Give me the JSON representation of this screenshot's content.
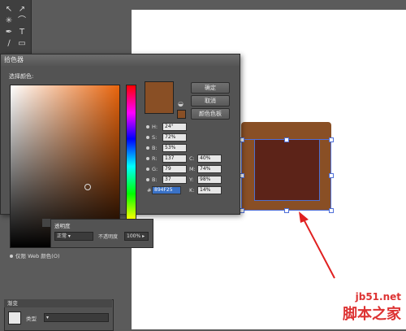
{
  "dialog": {
    "title": "拾色器",
    "select_label": "选择颜色:",
    "ok": "确定",
    "cancel": "取消",
    "swatches": "颜色色板",
    "web_only": "仅限 Web 颜色(O)",
    "current_color": "#894F25",
    "fields": [
      {
        "label": "H:",
        "value": "24°"
      },
      {
        "label": "S:",
        "value": "72%"
      },
      {
        "label": "B:",
        "value": "53%"
      },
      {
        "label": "R:",
        "value": "137"
      },
      {
        "label": "G:",
        "value": "79"
      },
      {
        "label": "B:",
        "value": "37"
      }
    ],
    "cmyk": [
      {
        "label": "C:",
        "value": "40%"
      },
      {
        "label": "M:",
        "value": "74%"
      },
      {
        "label": "Y:",
        "value": "98%"
      },
      {
        "label": "K:",
        "value": "14%"
      }
    ],
    "hex_prefix": "#",
    "hex_value": "894F25"
  },
  "transparency": {
    "tab": "透明度",
    "blend_mode": "正常",
    "opacity_label": "不透明度",
    "opacity_value": "100%"
  },
  "gradient": {
    "tab": "渐变",
    "type_label": "类型"
  },
  "watermark": {
    "line1": "jb51.net",
    "line2": "脚本之家"
  }
}
